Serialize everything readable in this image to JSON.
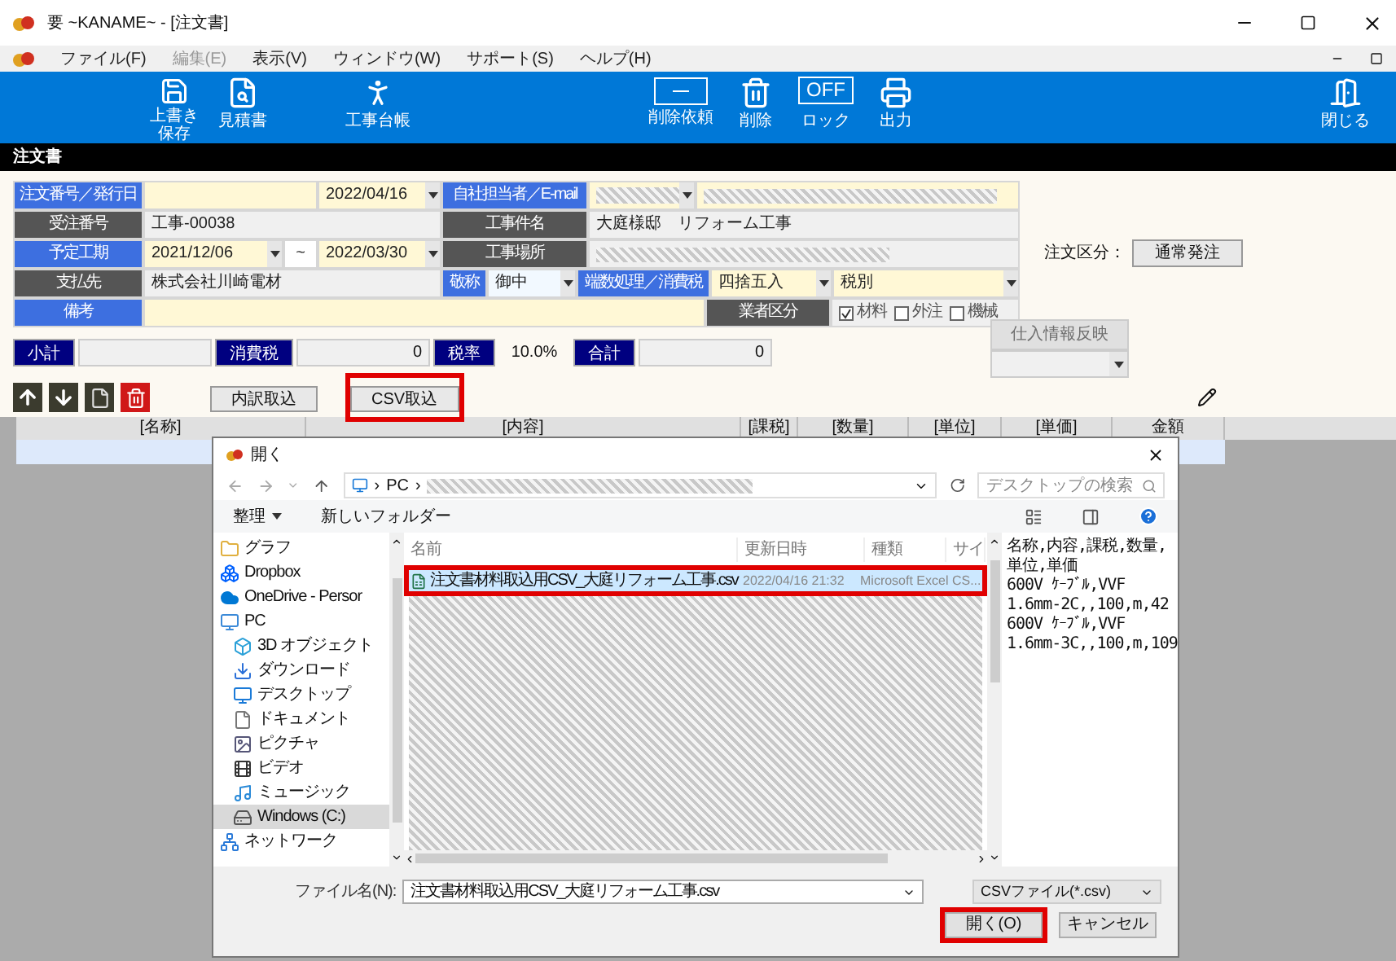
{
  "window": {
    "title": "要 ~KANAME~ - [注文書]"
  },
  "menu": [
    {
      "label": "ファイル(F)",
      "disabled": false
    },
    {
      "label": "編集(E)",
      "disabled": true
    },
    {
      "label": "表示(V)",
      "disabled": false
    },
    {
      "label": "ウィンドウ(W)",
      "disabled": false
    },
    {
      "label": "サポート(S)",
      "disabled": false
    },
    {
      "label": "ヘルプ(H)",
      "disabled": false
    }
  ],
  "toolbar": {
    "left": [
      {
        "kind": "save",
        "label": "上書き保存"
      },
      {
        "kind": "estimate",
        "label": "見積書"
      },
      {
        "kind": "ledger",
        "label": "工事台帳"
      }
    ],
    "center": [
      {
        "kind": "request-delete",
        "label": "削除依頼"
      },
      {
        "kind": "delete",
        "label": "削除"
      },
      {
        "kind": "lock",
        "badge": "OFF",
        "label": "ロック"
      },
      {
        "kind": "print",
        "label": "出力"
      }
    ],
    "right": [
      {
        "kind": "close",
        "label": "閉じる"
      }
    ]
  },
  "section_title": "注文書",
  "form_rows": [
    [
      {
        "kind": "label",
        "text": "注文番号／発行日",
        "color": "#3d6fe0"
      },
      {
        "kind": "field",
        "color": "#fff8d6"
      },
      {
        "kind": "select",
        "text": "2022/04/16",
        "color": "#fff8d6"
      },
      {
        "kind": "label",
        "text": "自社担当者／E-mail",
        "color": "#3d6fe0"
      },
      {
        "kind": "redacted-select",
        "color": "#fff8d6"
      },
      {
        "kind": "redacted-field",
        "color": "#fff8d6"
      }
    ],
    [
      {
        "kind": "label",
        "text": "受注番号",
        "color": "#555555"
      },
      {
        "kind": "field",
        "text": "工事-00038",
        "color": "#f0f0f0"
      },
      {
        "kind": "label",
        "text": "工事件名",
        "color": "#555555"
      },
      {
        "kind": "field",
        "text": "大庭様邸　リフォーム工事",
        "color": "#f0f0f0"
      }
    ],
    [
      {
        "kind": "label",
        "text": "予定工期",
        "color": "#3d6fe0"
      },
      {
        "kind": "select",
        "text": "2021/12/06",
        "color": "#fff8d6"
      },
      {
        "kind": "tilde",
        "text": "~",
        "color": "#ffffff"
      },
      {
        "kind": "select",
        "text": "2022/03/30",
        "color": "#fff8d6"
      },
      {
        "kind": "label",
        "text": "工事場所",
        "color": "#555555"
      },
      {
        "kind": "redacted-field",
        "color": "#f0f0f0"
      }
    ],
    [
      {
        "kind": "label",
        "text": "支払先",
        "color": "#555555"
      },
      {
        "kind": "field",
        "text": "株式会社川崎電材",
        "color": "#f0f0f0"
      },
      {
        "kind": "label",
        "text": "敬称",
        "color": "#3d6fe0"
      },
      {
        "kind": "select",
        "text": "御中",
        "color": "#f2f9ff"
      },
      {
        "kind": "label",
        "text": "端数処理／消費税",
        "color": "#3d6fe0"
      },
      {
        "kind": "select",
        "text": "四捨五入",
        "color": "#fff8d6"
      },
      {
        "kind": "select",
        "text": "税別",
        "color": "#fff8d6"
      }
    ],
    [
      {
        "kind": "label",
        "text": "備考",
        "color": "#3d6fe0"
      },
      {
        "kind": "field",
        "color": "#fff8d6"
      },
      {
        "kind": "label",
        "text": "業者区分",
        "color": "#555555"
      },
      {
        "kind": "checks",
        "color": "#f0f0f0",
        "items": [
          {
            "label": "材料",
            "checked": true
          },
          {
            "label": "外注",
            "checked": false
          },
          {
            "label": "機械",
            "checked": false
          }
        ]
      }
    ]
  ],
  "order_type": {
    "label": "注文区分：",
    "button": "通常発注"
  },
  "totals": [
    {
      "label": "小計",
      "kind": "field"
    },
    {
      "label": "消費税",
      "kind": "field",
      "value": "0"
    },
    {
      "label": "税率",
      "kind": "plain",
      "value": "10.0%"
    },
    {
      "label": "合計",
      "kind": "field",
      "value": "0"
    }
  ],
  "purchase_reflect": {
    "label": "仕入情報反映",
    "disabled": true
  },
  "row_tools": [
    {
      "kind": "up"
    },
    {
      "kind": "down"
    },
    {
      "kind": "document"
    },
    {
      "kind": "trash"
    }
  ],
  "import_buttons": [
    {
      "label": "内訳取込",
      "highlighted": false
    },
    {
      "label": "CSV取込",
      "highlighted": true
    }
  ],
  "grid": {
    "columns": [
      "[名称]",
      "[内容]",
      "[課税]",
      "[数量]",
      "[単位]",
      "[単価]",
      "金額"
    ]
  },
  "dialog": {
    "title": "開く",
    "path": [
      "PC"
    ],
    "path_separator": "›",
    "search": {
      "placeholder": "デスクトップの検索"
    },
    "commands": [
      {
        "label": "整理",
        "menu": true
      },
      {
        "label": "新しいフォルダー",
        "menu": false
      }
    ],
    "sidebar": [
      {
        "label": "グラフ",
        "kind": "folder",
        "selected": false
      },
      {
        "label": "Dropbox",
        "kind": "dropbox",
        "selected": false
      },
      {
        "label": "OneDrive - Persor",
        "kind": "cloud",
        "selected": false
      },
      {
        "label": "PC",
        "kind": "pc",
        "selected": false,
        "children": [
          {
            "label": "3D オブジェクト",
            "kind": "cube",
            "selected": false
          },
          {
            "label": "ダウンロード",
            "kind": "download",
            "selected": false
          },
          {
            "label": "デスクトップ",
            "kind": "desktop",
            "selected": false
          },
          {
            "label": "ドキュメント",
            "kind": "document",
            "selected": false
          },
          {
            "label": "ピクチャ",
            "kind": "picture",
            "selected": false
          },
          {
            "label": "ビデオ",
            "kind": "video",
            "selected": false
          },
          {
            "label": "ミュージック",
            "kind": "music",
            "selected": false
          },
          {
            "label": "Windows (C:)",
            "kind": "drive",
            "selected": true
          }
        ]
      },
      {
        "label": "ネットワーク",
        "kind": "network",
        "selected": false
      }
    ],
    "columns": [
      "名前",
      "更新日時",
      "種類",
      "サイ"
    ],
    "files": [
      {
        "name": "注文書材料取込用CSV_大庭リフォーム工事.csv",
        "date": "2022/04/16 21:32",
        "type": "Microsoft Excel CS...",
        "selected": true,
        "highlighted": true
      }
    ],
    "preview": [
      "名称,内容,課税,数量,",
      "単位,単価",
      "600V ｹｰﾌﾞﾙ,VVF",
      "1.6mm-2C,,100,m,42",
      "600V ｹｰﾌﾞﾙ,VVF",
      "1.6mm-3C,,100,m,109"
    ],
    "filename_label": "ファイル名(N):",
    "filename": "注文書材料取込用CSV_大庭リフォーム工事.csv",
    "filter": "CSVファイル(*.csv)",
    "buttons": [
      {
        "label": "開く(O)",
        "highlighted": true
      },
      {
        "label": "キャンセル",
        "highlighted": false
      }
    ]
  }
}
